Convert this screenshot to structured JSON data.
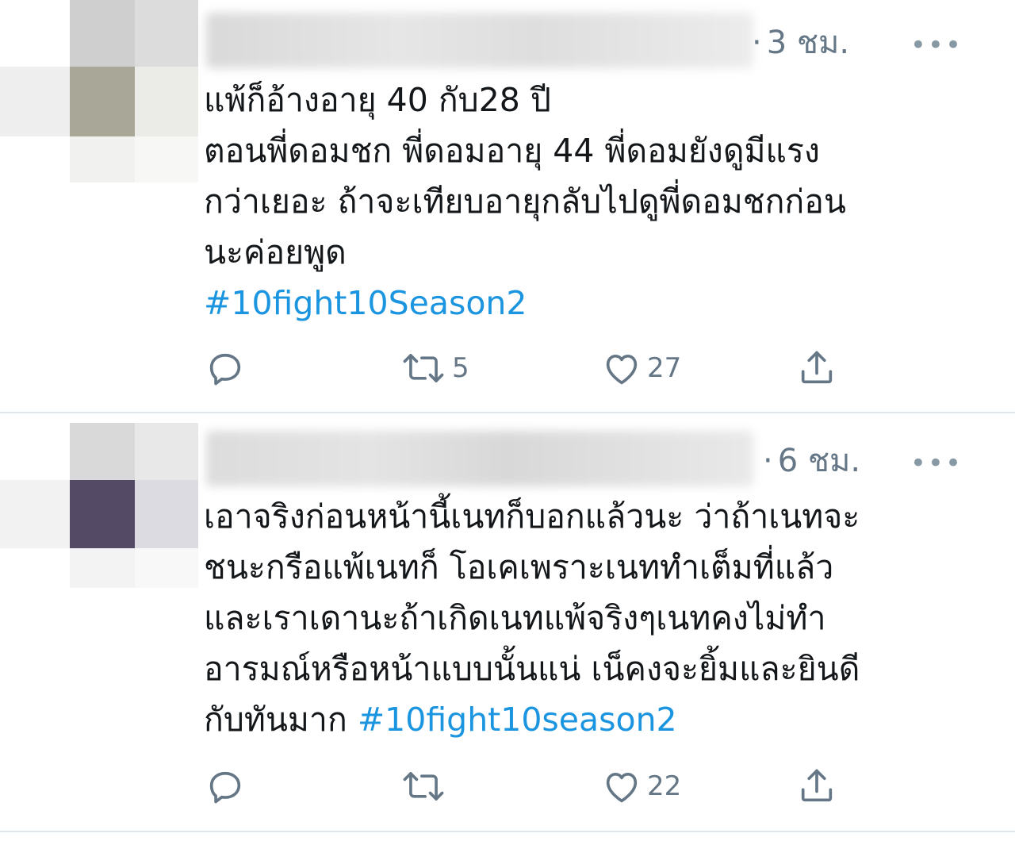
{
  "tweets": [
    {
      "time": "3 ชม.",
      "more": "•••",
      "lines": [
        "แพ้ก็อ้างอายุ 40 กับ28 ปี",
        "ตอนพี่ดอมชก พี่ดอมอายุ 44 พี่ดอมยังดูมีแรง",
        "กว่าเยอะ ถ้าจะเทียบอายุกลับไปดูพี่ดอมชกก่อน",
        "นะค่อยพูด"
      ],
      "hashtag": "#10fight10Season2",
      "reply_count": "",
      "retweet_count": "5",
      "like_count": "27"
    },
    {
      "time": "6 ชม.",
      "more": "•••",
      "lines": [
        "เอาจริงก่อนหน้านี้เนทก็บอกแล้วนะ ว่าถ้าเนทจะ",
        "ชนะกรือแพ้เนทก็ โอเคเพราะเนททำเต็มที่แล้ว",
        "และเราเดานะถ้าเกิดเนทแพ้จริงๆเนทคงไม่ทำ",
        "อารมณ์หรือหน้าแบบนั้นแน่ เน็คงจะยิ้มและยินดี"
      ],
      "last_line_text": "กับทันมาก ",
      "hashtag": "#10fight10season2",
      "reply_count": "",
      "retweet_count": "",
      "like_count": "22"
    }
  ],
  "colors": {
    "text": "#14171a",
    "secondary": "#657786",
    "hashtag": "#1b95e0",
    "divider": "#e1e8ed"
  },
  "icons": [
    "reply-icon",
    "retweet-icon",
    "like-icon",
    "share-icon",
    "more-icon"
  ]
}
